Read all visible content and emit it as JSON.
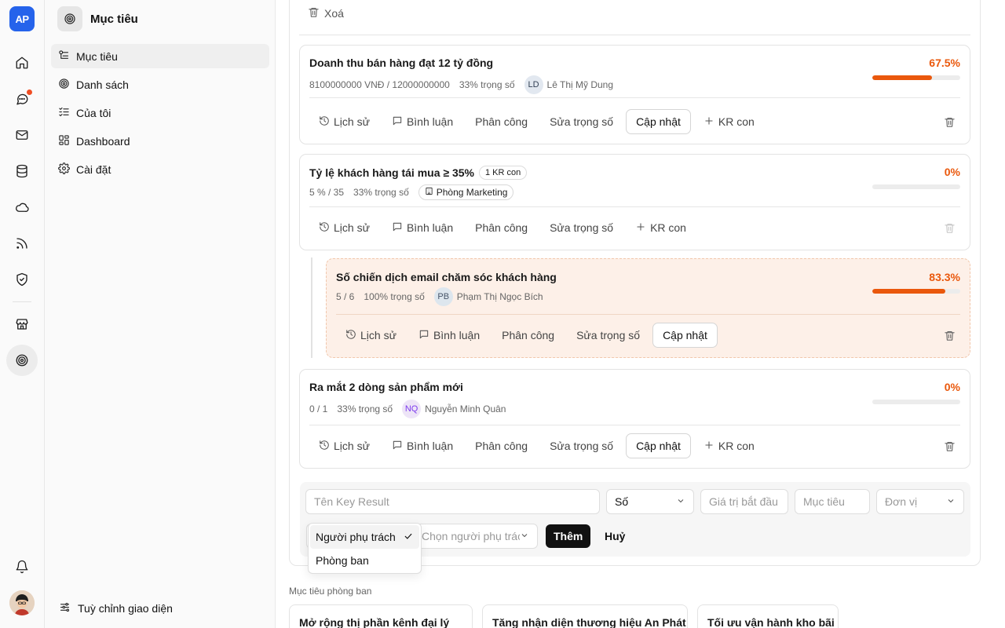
{
  "app": {
    "logo_text": "AP"
  },
  "rail": {
    "icons": [
      "home-icon",
      "chat-icon",
      "mail-icon",
      "database-icon",
      "cloud-icon",
      "rss-icon",
      "shield-icon",
      "store-icon",
      "target-icon",
      "bell-icon"
    ],
    "notification_dot_color": "#f04e23",
    "active": "target-icon"
  },
  "sidebar": {
    "title": "Mục tiêu",
    "items": [
      {
        "label": "Mục tiêu",
        "icon": "objectives-icon",
        "active": true
      },
      {
        "label": "Danh sách",
        "icon": "target-icon"
      },
      {
        "label": "Của tôi",
        "icon": "checklist-icon"
      },
      {
        "label": "Dashboard",
        "icon": "dashboard-icon"
      },
      {
        "label": "Cài đặt",
        "icon": "gear-icon"
      }
    ],
    "customize_label": "Tuỳ chỉnh giao diện"
  },
  "main": {
    "delete_label": "Xoá",
    "actions": {
      "history": "Lịch sử",
      "comment": "Bình luận",
      "assign": "Phân công",
      "edit_weight": "Sửa trọng số",
      "update": "Cập nhật",
      "add_child": "KR con"
    },
    "key_results": [
      {
        "title": "Doanh thu bán hàng đạt 12 tỷ đồng",
        "progress_text": "8100000000 VNĐ / 12000000000",
        "weight": "33% trọng số",
        "owner_initials": "LD",
        "owner_name": "Lê Thị Mỹ Dung",
        "percent": "67.5%",
        "progress": 0.675
      },
      {
        "title": "Tỷ lệ khách hàng tái mua ≥ 35%",
        "badge": "1 KR con",
        "progress_text": "5 % / 35",
        "weight": "33% trọng số",
        "department": "Phòng Marketing",
        "percent": "0%",
        "progress": 0
      },
      {
        "title": "Số chiến dịch email chăm sóc khách hàng",
        "progress_text": "5 / 6",
        "weight": "100% trọng số",
        "owner_initials": "PB",
        "owner_name": "Phạm Thị Ngọc Bích",
        "percent": "83.3%",
        "progress": 0.833
      },
      {
        "title": "Ra mắt 2 dòng sản phẩm mới",
        "progress_text": "0 / 1",
        "weight": "33% trọng số",
        "owner_initials": "NQ",
        "owner_name": "Nguyễn Minh Quân",
        "percent": "0%",
        "progress": 0
      }
    ],
    "form": {
      "name_placeholder": "Tên Key Result",
      "type_value": "Số",
      "start_placeholder": "Giá trị bắt đầu",
      "target_placeholder": "Mục tiêu",
      "unit_placeholder": "Đơn vị",
      "owner_select_placeholder": "Chọn người phụ trách",
      "add_label": "Thêm",
      "cancel_label": "Huỷ",
      "dropdown_options": [
        "Người phụ trách",
        "Phòng ban"
      ],
      "dropdown_selected": "Người phụ trách"
    },
    "department_section": {
      "label": "Mục tiêu phòng ban",
      "cards": [
        "Mở rộng thị phần kênh đại lý",
        "Tăng nhận diện thương hiệu An Phát",
        "Tối ưu vận hành kho bãi"
      ]
    }
  },
  "colors": {
    "accent": "#ea580c",
    "brand": "#2563eb"
  }
}
